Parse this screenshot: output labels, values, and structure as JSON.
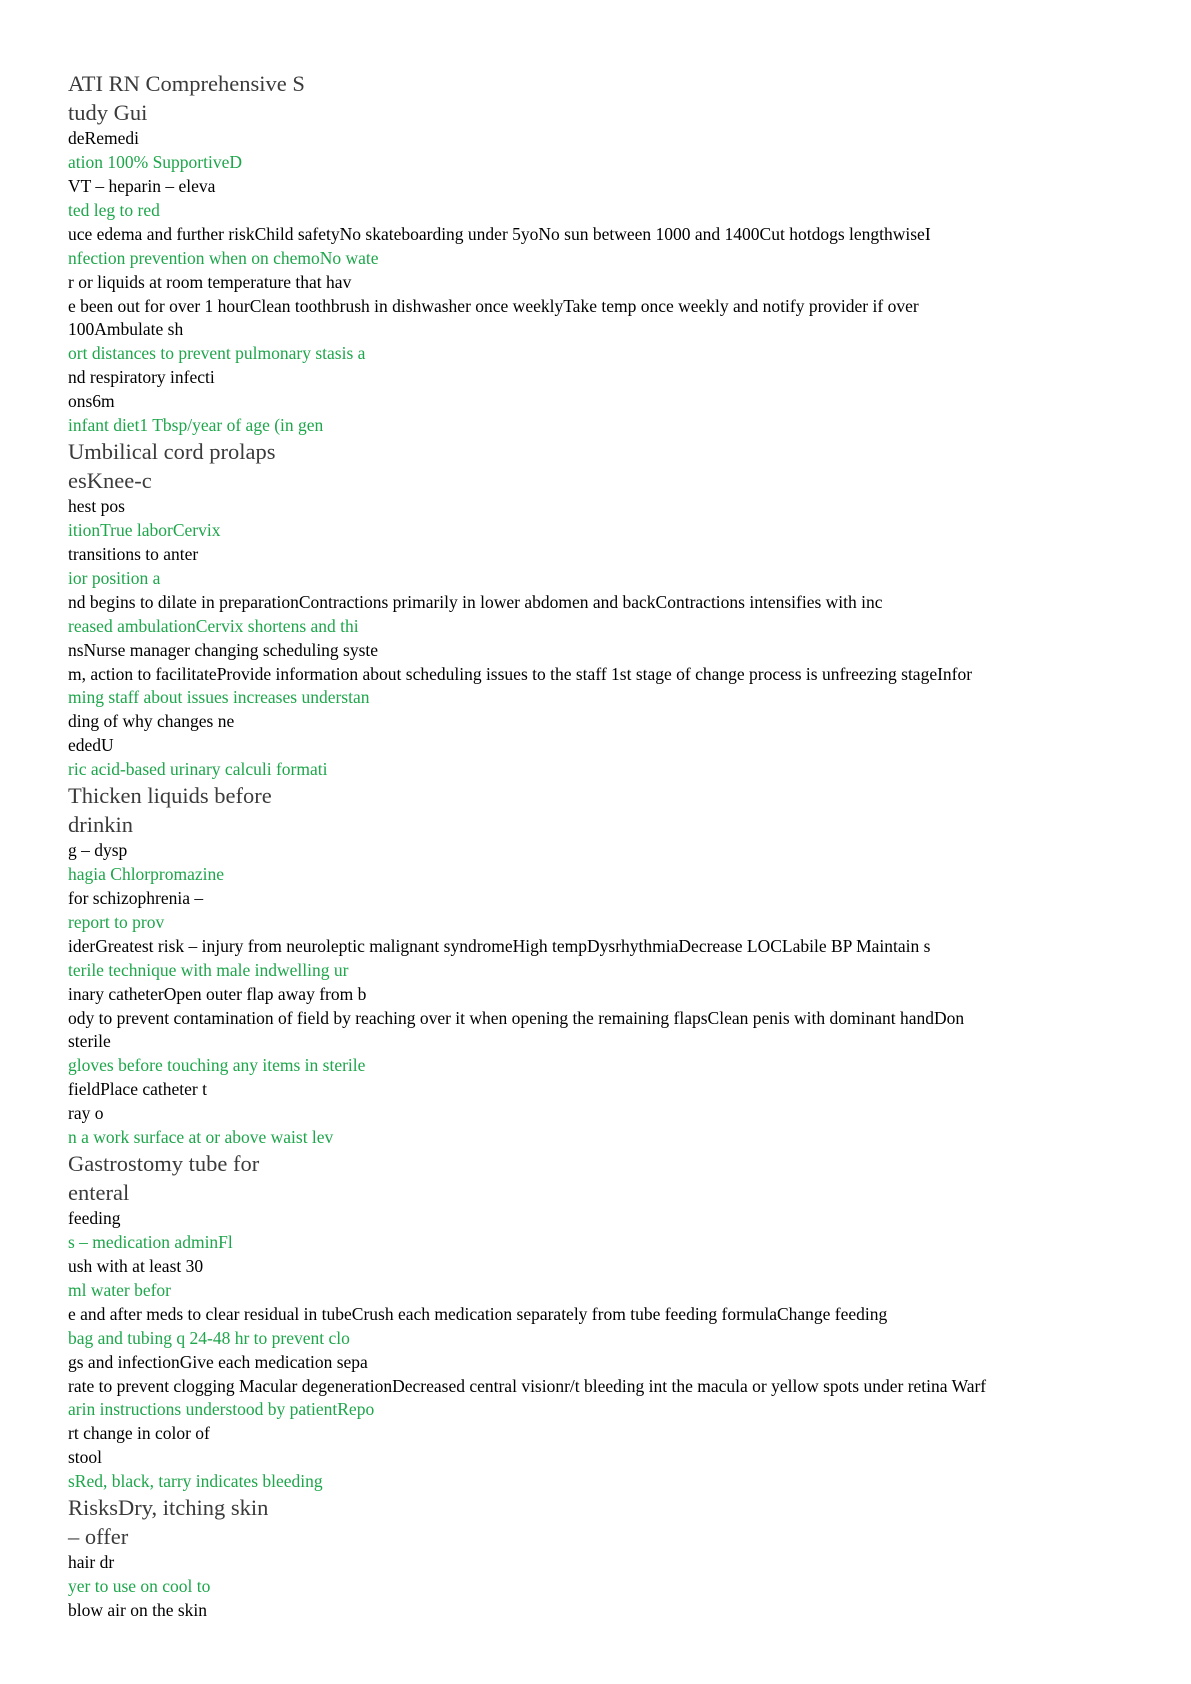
{
  "document": {
    "lines": [
      {
        "text": "ATI RN Comprehensive S",
        "style": "heading"
      },
      {
        "text": "tudy Gui",
        "style": "heading"
      },
      {
        "text": "deRemedi",
        "style": "black"
      },
      {
        "text": "ation 100% SupportiveD",
        "style": "green"
      },
      {
        "text": "VT – heparin – eleva",
        "style": "black"
      },
      {
        "text": "ted leg to red",
        "style": "green"
      },
      {
        "text": "uce edema and further riskChild safetyNo skateboarding under 5yoNo sun between 1000 and 1400Cut hotdogs lengthwiseI",
        "style": "black"
      },
      {
        "text": "nfection prevention when on chemoNo wate",
        "style": "green"
      },
      {
        "text": "r or liquids at room temperature that hav",
        "style": "black"
      },
      {
        "text": "e been out for over 1 hourClean toothbrush in dishwasher once weeklyTake temp once weekly and notify provider if over",
        "style": "black"
      },
      {
        "text": "100Ambulate sh",
        "style": "black"
      },
      {
        "text": "ort distances to prevent pulmonary stasis a",
        "style": "green"
      },
      {
        "text": "nd respiratory infecti",
        "style": "black"
      },
      {
        "text": "ons6m",
        "style": "black"
      },
      {
        "text": "infant diet1 Tbsp/year of age (in gen",
        "style": "green"
      },
      {
        "text": "Umbilical cord prolaps",
        "style": "heading"
      },
      {
        "text": "esKnee-c",
        "style": "heading"
      },
      {
        "text": "hest pos",
        "style": "black"
      },
      {
        "text": "itionTrue laborCervix",
        "style": "green"
      },
      {
        "text": "transitions to anter",
        "style": "black"
      },
      {
        "text": "ior position a",
        "style": "green"
      },
      {
        "text": "nd begins to dilate in preparationContractions primarily in lower abdomen and backContractions intensifies with inc",
        "style": "black"
      },
      {
        "text": "reased ambulationCervix shortens and thi",
        "style": "green"
      },
      {
        "text": "nsNurse manager changing scheduling syste",
        "style": "black"
      },
      {
        "text": "m, action to facilitateProvide information about scheduling issues to the staff 1st stage of change process is unfreezing stageInfor",
        "style": "black"
      },
      {
        "text": "ming staff about issues increases understan",
        "style": "green"
      },
      {
        "text": "ding of why changes ne",
        "style": "black"
      },
      {
        "text": "ededU",
        "style": "black"
      },
      {
        "text": "ric acid-based urinary calculi formati",
        "style": "green"
      },
      {
        "text": "Thicken liquids before",
        "style": "heading"
      },
      {
        "text": "drinkin",
        "style": "heading"
      },
      {
        "text": "g – dysp",
        "style": "black"
      },
      {
        "text": "hagia Chlorpromazine",
        "style": "green"
      },
      {
        "text": "for schizophrenia –",
        "style": "black"
      },
      {
        "text": "report to prov",
        "style": "green"
      },
      {
        "text": "iderGreatest risk – injury from neuroleptic malignant syndromeHigh tempDysrhythmiaDecrease LOCLabile BP Maintain s",
        "style": "black"
      },
      {
        "text": "terile technique with male indwelling ur",
        "style": "green"
      },
      {
        "text": "inary catheterOpen outer flap away from b",
        "style": "black"
      },
      {
        "text": "ody to prevent contamination of field by reaching over it when opening the remaining flapsClean penis with dominant handDon",
        "style": "black"
      },
      {
        "text": "sterile",
        "style": "black"
      },
      {
        "text": "gloves before touching any items in sterile",
        "style": "green"
      },
      {
        "text": "fieldPlace catheter t",
        "style": "black"
      },
      {
        "text": "ray o",
        "style": "black"
      },
      {
        "text": "n a work surface at or above waist lev",
        "style": "green"
      },
      {
        "text": "Gastrostomy tube for",
        "style": "heading"
      },
      {
        "text": "enteral",
        "style": "heading"
      },
      {
        "text": "feeding",
        "style": "black"
      },
      {
        "text": "s – medication adminFl",
        "style": "green"
      },
      {
        "text": "ush with at least 30",
        "style": "black"
      },
      {
        "text": "ml water befor",
        "style": "green"
      },
      {
        "text": "e and after meds to clear residual in tubeCrush each medication separately from tube feeding formulaChange feeding",
        "style": "black"
      },
      {
        "text": "bag and tubing q 24-48 hr to prevent clo",
        "style": "green"
      },
      {
        "text": "gs and infectionGive each medication sepa",
        "style": "black"
      },
      {
        "text": "rate to prevent clogging Macular degenerationDecreased central visionr/t bleeding int the macula or yellow spots under retina Warf",
        "style": "black"
      },
      {
        "text": "arin instructions understood by patientRepo",
        "style": "green"
      },
      {
        "text": "rt change in color of",
        "style": "black"
      },
      {
        "text": "stool",
        "style": "black"
      },
      {
        "text": "sRed, black, tarry indicates bleeding",
        "style": "green"
      },
      {
        "text": "RisksDry, itching skin",
        "style": "heading"
      },
      {
        "text": "– offer",
        "style": "heading"
      },
      {
        "text": "hair dr",
        "style": "black"
      },
      {
        "text": "yer to use on cool to",
        "style": "green"
      },
      {
        "text": "blow air on the skin",
        "style": "black"
      }
    ]
  },
  "colors": {
    "text": "#000000",
    "accent_green": "#1ea64b",
    "heading_gray": "#3b3b3b"
  }
}
